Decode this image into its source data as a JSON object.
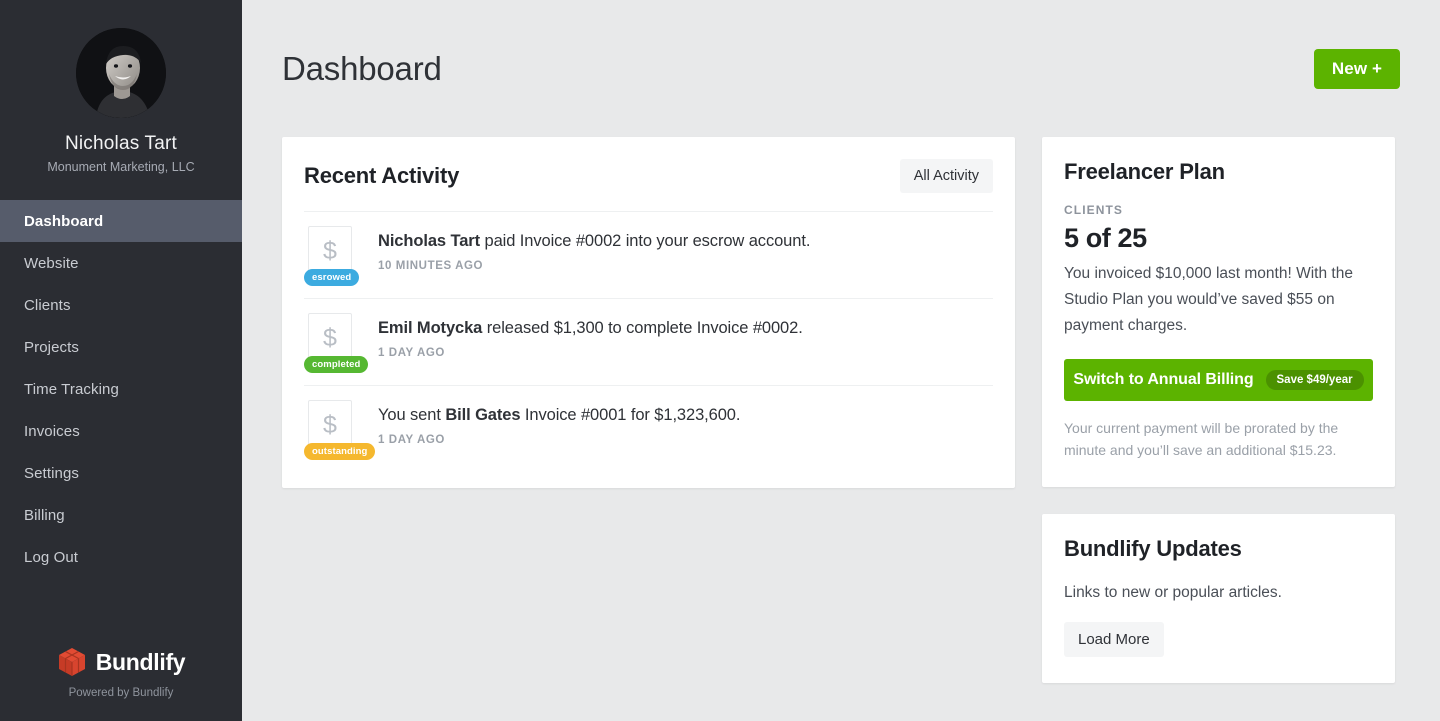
{
  "sidebar": {
    "profile": {
      "avatar_icon": "user-avatar-photo",
      "name": "Nicholas Tart",
      "company": "Monument Marketing, LLC"
    },
    "items": [
      {
        "label": "Dashboard",
        "active": true
      },
      {
        "label": "Website",
        "active": false
      },
      {
        "label": "Clients",
        "active": false
      },
      {
        "label": "Projects",
        "active": false
      },
      {
        "label": "Time Tracking",
        "active": false
      },
      {
        "label": "Invoices",
        "active": false
      },
      {
        "label": "Settings",
        "active": false
      },
      {
        "label": "Billing",
        "active": false
      },
      {
        "label": "Log Out",
        "active": false
      }
    ],
    "footer": {
      "logo_icon": "bundlify-cube-logo",
      "brand": "Bundlify",
      "powered_by": "Powered by Bundlify"
    },
    "colors": {
      "background": "#2b2d33",
      "active_item": "#565c6b",
      "logo": "#e04a32"
    }
  },
  "header": {
    "title": "Dashboard",
    "new_button": "New +"
  },
  "recent_activity": {
    "title": "Recent Activity",
    "all_activity_button": "All Activity",
    "items": [
      {
        "icon": "invoice-dollar-icon",
        "symbol": "$",
        "badge": "esrowed",
        "badge_color": "#3cabe0",
        "actor": "Nicholas Tart",
        "actor_position": "start",
        "text_before": "",
        "text_after": " paid Invoice #0002 into your escrow account.",
        "time": "10 MINUTES AGO"
      },
      {
        "icon": "invoice-dollar-icon",
        "symbol": "$",
        "badge": "completed",
        "badge_color": "#56b832",
        "actor": "Emil Motycka",
        "actor_position": "start",
        "text_before": "",
        "text_after": " released $1,300 to complete Invoice #0002.",
        "time": "1 DAY AGO"
      },
      {
        "icon": "invoice-dollar-icon",
        "symbol": "$",
        "badge": "outstanding",
        "badge_color": "#f5b82e",
        "actor": "Bill Gates",
        "actor_position": "middle",
        "text_before": "You sent ",
        "text_after": " Invoice #0001 for $1,323,600.",
        "time": "1 DAY AGO"
      }
    ]
  },
  "plan": {
    "title": "Freelancer Plan",
    "metric_label": "CLIENTS",
    "metric_value": "5 of 25",
    "description": "You invoiced $10,000 last month! With the Studio Plan you would’ve saved $55 on payment charges.",
    "cta_label": "Switch to Annual Billing",
    "cta_badge": "Save $49/year",
    "cta_color": "#5cb300",
    "note": "Your current payment will be prorated by the minute and you’ll save an additional $15.23."
  },
  "updates": {
    "title": "Bundlify Updates",
    "description": "Links to new or popular articles.",
    "load_more_button": "Load More"
  }
}
